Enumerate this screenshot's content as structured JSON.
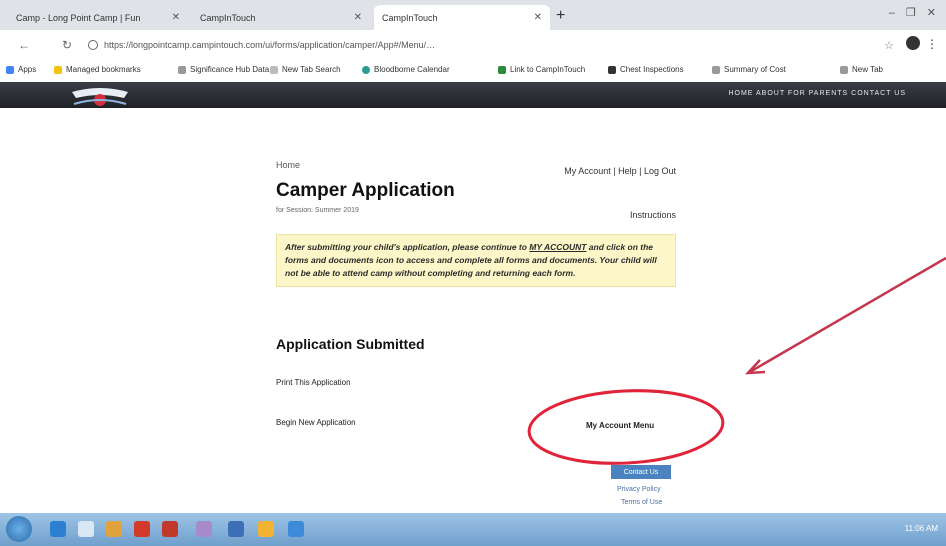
{
  "browser": {
    "tabs": [
      {
        "label": "Camp - Long Point Camp | Fun",
        "active": false
      },
      {
        "label": "CampInTouch",
        "active": false
      },
      {
        "label": "CampInTouch",
        "active": true
      }
    ],
    "new_tab_symbol": "+",
    "window_controls": "– ❐ ✕",
    "url": "https://longpointcamp.campintouch.com/ui/forms/application/camper/App#/Menu/…",
    "bookmarks": [
      "Apps",
      "Managed bookmarks",
      "Significance Hub Data",
      "New Tab Search",
      "Bloodborne Calendar",
      "Link to CampInTouch",
      "Chest Inspections",
      "Summary of Cost",
      "New Tab"
    ]
  },
  "site": {
    "nav_text": "HOME    ABOUT    FOR PARENTS    CONTACT US"
  },
  "page": {
    "breadcrumb": "Home",
    "account_links": "My Account | Help | Log Out",
    "title": "Camper Application",
    "subtitle": "for Session: Summer 2019",
    "instructions_link": "Instructions",
    "notice_pre": "After submitting your child's application, please continue to ",
    "notice_link": "MY ACCOUNT",
    "notice_post": " and click on the forms and documents icon to access and complete all forms and documents. Your child will not be able to attend camp without completing and returning each form.",
    "submitted_heading": "Application Submitted",
    "print_link": "Print This Application",
    "new_app_link": "Begin New Application",
    "my_account_menu": "My Account Menu",
    "contact_button": "Contact Us",
    "privacy_link": "Privacy Policy",
    "terms_link": "Terms of Use"
  },
  "taskbar": {
    "clock": "11:06 AM"
  },
  "colors": {
    "annotation": "#e0253a",
    "notice_bg": "#fdf6c8",
    "button": "#4a83bf",
    "header": "#2a2c31"
  }
}
